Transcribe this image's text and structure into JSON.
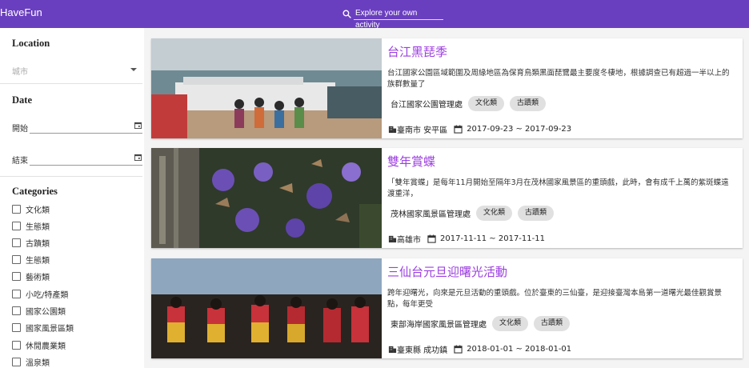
{
  "header": {
    "brand": "HaveFun",
    "search_placeholder": "Explore your own activity"
  },
  "sidebar": {
    "location_title": "Location",
    "location_value": "城市",
    "date_title": "Date",
    "date_start_label": "開始",
    "date_end_label": "結束",
    "categories_title": "Categories",
    "categories": [
      "文化類",
      "生態類",
      "古蹟類",
      "生態類",
      "藝術類",
      "小吃/特產類",
      "國家公園類",
      "國家風景區類",
      "休閒農業類",
      "溫泉類"
    ]
  },
  "cards": [
    {
      "title": "台江黑琵季",
      "description": "台江國家公園區域範圍及周緣地區為保育鳥類黑面琵鷺最主要度冬棲地，根據調查已有超過一半以上的族群數量了",
      "organizer": "台江國家公園管理處",
      "tags": [
        "文化類",
        "古蹟類"
      ],
      "location": "臺南市 安平區",
      "dates": "2017-09-23 ~ 2017-09-23"
    },
    {
      "title": "雙年賞蝶",
      "description": "「雙年賞蝶」是每年11月開始至隔年3月在茂林國家風景區的重頭戲，此時，會有成千上萬的紫斑蝶遠渡重洋，",
      "organizer": "茂林國家風景區管理處",
      "tags": [
        "文化類",
        "古蹟類"
      ],
      "location": "高雄市",
      "dates": "2017-11-11 ~ 2017-11-11"
    },
    {
      "title": "三仙台元旦迎曙光活動",
      "description": "跨年迎曙光，向來是元旦活動的重頭戲。位於臺東的三仙臺，是迎接臺灣本島第一道曙光最佳觀賞景點，每年更受",
      "organizer": "東部海岸國家風景區管理處",
      "tags": [
        "文化類",
        "古蹟類"
      ],
      "location": "臺東縣 成功鎮",
      "dates": "2018-01-01 ~ 2018-01-01"
    }
  ]
}
